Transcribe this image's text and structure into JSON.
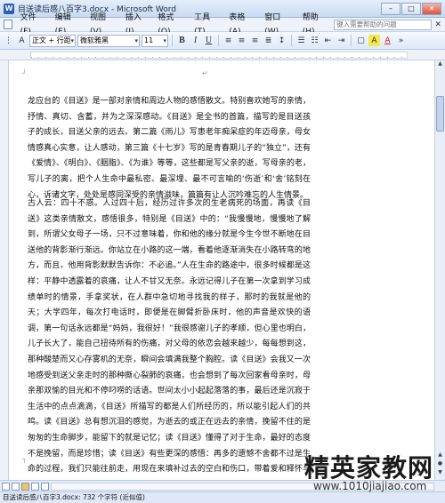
{
  "window": {
    "title": "目送读后感八百字3.docx - Microsoft Word",
    "min_label": "–",
    "max_label": "□",
    "close_label": "✕"
  },
  "menu": {
    "items": [
      "文件(F)",
      "编辑(E)",
      "视图(V)",
      "插入(I)",
      "格式(O)",
      "工具(T)",
      "表格(A)",
      "窗口(W)",
      "帮助(H)"
    ],
    "help_placeholder": "键入需要帮助的问题",
    "close_label": "✕"
  },
  "toolbar": {
    "style_value": "正文 + 行距",
    "font_value": "微软雅黑",
    "size_value": "11",
    "bold": "B",
    "italic": "I",
    "underline": "U",
    "highlight": "A",
    "fontcolor": "A"
  },
  "document": {
    "return_mark": "↵",
    "paragraphs": [
      "龙应台的《目送》是一部对亲情和周边人物的感悟散文。特别喜欢她写的亲情，抒情、真切、含蓄，并为之深深感动。《目送》是全书的首篇，描写的是目送孩子的成长，目送父亲的远去。第二篇《雨儿》写患老年痴呆症的年迈母亲，母女情感真心实意，让人感动，第三篇《十七岁》写的是青春期儿子的“独立”，还有《爱情》、《明白》、《胭脂》、《为谁》等等，这些都是写父亲的逝，写母亲的老，写儿子的离，把个人生命中最私密、最深埋、最不可言喻的‘伤逝’和‘舍’铭刻在心，诉诸文字，处处是感同深受的亲情滋味，篇篇有让人沉吟难忘的人生情景。",
      "古人云：四十不惑。人过四十后，经历过许多次的生老病死的场面，再读《目送》这类亲情散文，感悟很多，特别是《目送》中的：“我慢慢地，慢慢地了解到，所谓父女母子一场，只不过意味着，你和他的缘分就是今生今世不断地在目送他的背影渐行渐远。你站立在小路的这一端，看着他逐渐消失在小路转弯的地方，而且，他用背影默默告诉你：不必追。”人在生命的路途中，很多时候都是这样：平静中透露着的哀痛，让人不甘又无奈。永远记得儿子在第一次拿到学习成绩单时的情景，手拿奖状，在人群中急切地寻找我的样子，那时的我就是他的天；大学四年，每次打电话时，即便是在脚臂折卧床时，他的声音是欢快的语调，第一句话永远都是“妈妈，我很好！”我很感谢儿子的孝顺，但心里也明白，儿子长大了，能自己扭待所有的伤痛，对父母的依恋会越来越少，每每想到这，那种酸楚而又心存雾机的无奈，瞬间会填满我整个胸腔。读《目送》会我又一次地感受到送父亲走时的那种撕心裂肺的哀痛，也会想到了每次回家看母亲时，母亲那双愉的目光和不停叼唠的话语。世间太小小起起落落的事，最后还是沉寂于生活中的点点滴滴，《目送》所描写的都是人们所经历的，所以能引起人们的共鸣。读《目送》总有想沉泪的感觉，为逝去的或正在远去的亲情，挽留不住的是匆匆的生命脚步，能留下的就是记忆；读《目送》懂得了对于生命，最好的态度不是挽留，而是珍惜；读《目送》有些更深的感悟：再多的遗憾不舍都不过是生命的过程，我们只能往前走，用现在来填补过去的空白和伤口，带着爱和释怀与生命和解。"
    ]
  },
  "status": {
    "text": "目送读后感八百字3.docx: 732 个字符 (近似值)"
  },
  "watermark": {
    "line1": "精英家教网",
    "line2": "www.1010jiajiao.com"
  }
}
